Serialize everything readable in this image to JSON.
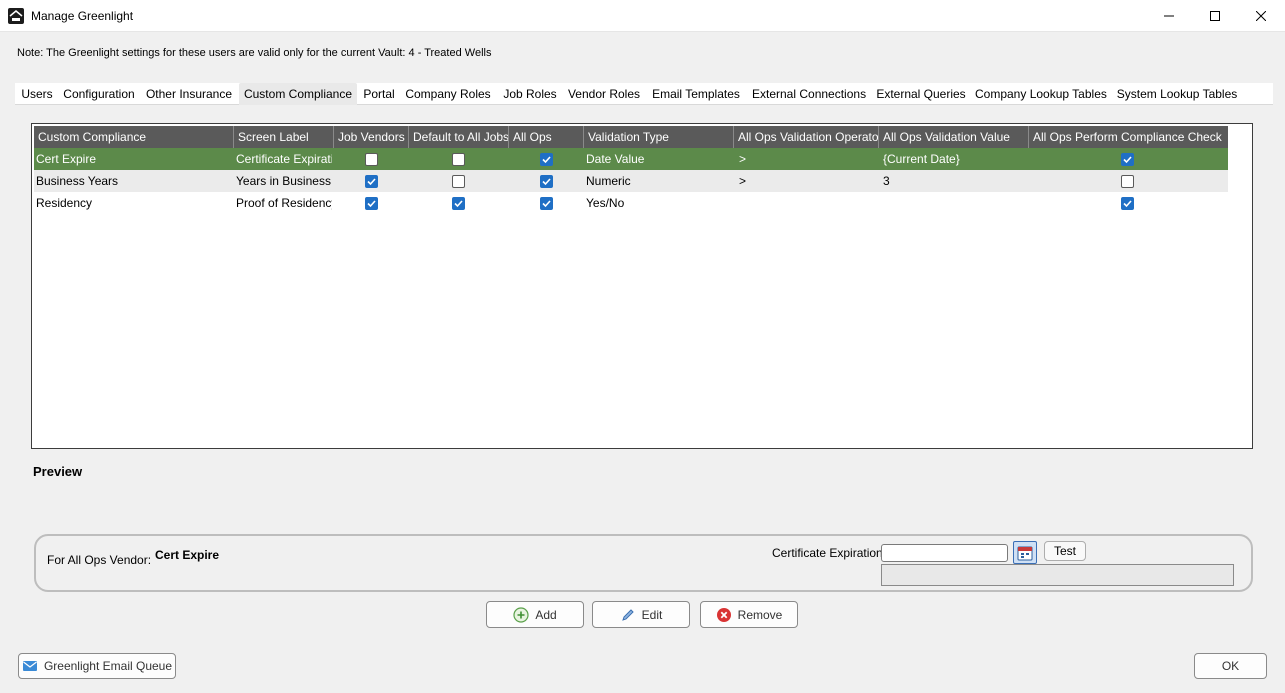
{
  "window": {
    "title": "Manage Greenlight",
    "minimize_icon": "minimize-icon",
    "maximize_icon": "maximize-icon",
    "close_icon": "close-icon"
  },
  "note": "Note:  The Greenlight settings for these users are valid only for the current Vault: 4 - Treated Wells",
  "tabs": [
    {
      "label": "Users"
    },
    {
      "label": "Configuration"
    },
    {
      "label": "Other Insurance"
    },
    {
      "label": "Custom Compliance",
      "active": true
    },
    {
      "label": "Portal"
    },
    {
      "label": "Company Roles"
    },
    {
      "label": "Job Roles"
    },
    {
      "label": "Vendor Roles"
    },
    {
      "label": "Email Templates"
    },
    {
      "label": "External Connections"
    },
    {
      "label": "External Queries"
    },
    {
      "label": "Company Lookup Tables"
    },
    {
      "label": "System Lookup Tables"
    }
  ],
  "grid": {
    "columns": [
      "Custom Compliance",
      "Screen Label",
      "Job Vendors",
      "Default to All Jobs",
      "All Ops",
      "Validation Type",
      "All Ops Validation Operator",
      "All Ops Validation Value",
      "All Ops Perform Compliance Check"
    ],
    "rows": [
      {
        "name": "Cert Expire",
        "screen_label": "Certificate Expirati...",
        "job_vendors": false,
        "default_all_jobs": false,
        "all_ops": true,
        "validation_type": "Date Value",
        "operator": ">",
        "value": "{Current Date}",
        "perform_check": true
      },
      {
        "name": "Business Years",
        "screen_label": "Years in Business",
        "job_vendors": true,
        "default_all_jobs": false,
        "all_ops": true,
        "validation_type": "Numeric",
        "operator": ">",
        "value": "3",
        "perform_check": false
      },
      {
        "name": "Residency",
        "screen_label": "Proof of Residency",
        "job_vendors": true,
        "default_all_jobs": true,
        "all_ops": true,
        "validation_type": "Yes/No",
        "operator": "",
        "value": "",
        "perform_check": true
      }
    ],
    "selected_color": "#5c8a4a"
  },
  "preview": {
    "heading": "Preview",
    "vendor_label": "For All Ops Vendor:",
    "vendor_value": "Cert Expire",
    "field_label": "Certificate Expiration",
    "date_value": "",
    "test_label": "Test",
    "calendar_icon": "calendar-icon"
  },
  "actions": {
    "add_label": "Add",
    "edit_label": "Edit",
    "remove_label": "Remove"
  },
  "footer": {
    "email_queue_label": "Greenlight Email Queue",
    "ok_label": "OK"
  }
}
